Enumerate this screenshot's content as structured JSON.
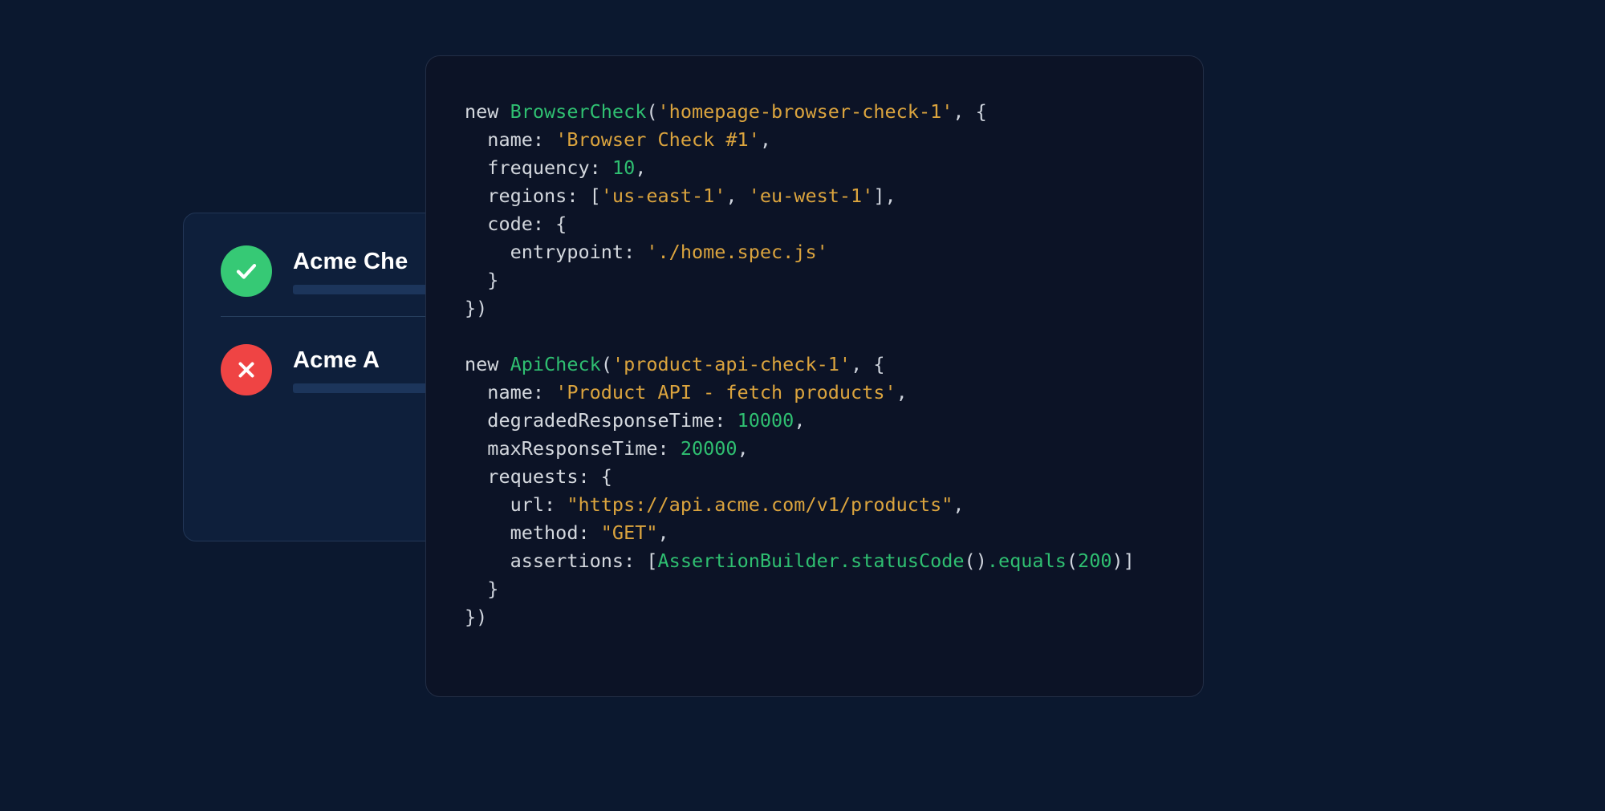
{
  "colors": {
    "bg": "#0b182f",
    "card_bg": "#0e1f3b",
    "card_border": "#223656",
    "code_bg": "#0c1326",
    "code_border": "#232e46",
    "success": "#36c975",
    "fail": "#ef4444",
    "bar": "#1c355b",
    "text": "#ffffff",
    "code_text": "#d4d8de",
    "code_class": "#2fbf71",
    "code_string": "#dba43e"
  },
  "checks": [
    {
      "status": "ok",
      "title": "Acme Che"
    },
    {
      "status": "fail",
      "title": "Acme A"
    }
  ],
  "code": {
    "browser_check": {
      "kw_new": "new ",
      "class": "BrowserCheck",
      "arg_id": "'homepage-browser-check-1'",
      "name_key": "name: ",
      "name_val": "'Browser Check #1'",
      "freq_key": "frequency: ",
      "freq_val": "10",
      "regions_key": "regions: [",
      "regions_v1": "'us-east-1'",
      "regions_sep": ", ",
      "regions_v2": "'eu-west-1'",
      "regions_close": "],",
      "code_key": "code: {",
      "entry_key": "entrypoint: ",
      "entry_val": "'./home.spec.js'",
      "close_brace": "}",
      "close_obj": "})"
    },
    "api_check": {
      "kw_new": "new ",
      "class": "ApiCheck",
      "arg_id": "'product-api-check-1'",
      "name_key": "name: ",
      "name_val": "'Product API - fetch products'",
      "degraded_key": "degradedResponseTime: ",
      "degraded_val": "10000",
      "max_key": "maxResponseTime: ",
      "max_val": "20000",
      "req_key": "requests: {",
      "url_key": "url: ",
      "url_val": "\"https://api.acme.com/v1/products\"",
      "method_key": "method: ",
      "method_val": "\"GET\"",
      "assert_key": "assertions: [",
      "assert_builder": "AssertionBuilder",
      "assert_status": ".statusCode",
      "assert_equals": ".equals",
      "assert_arg": "200",
      "assert_close": ")]",
      "close_brace": "}",
      "close_obj": "})"
    }
  }
}
